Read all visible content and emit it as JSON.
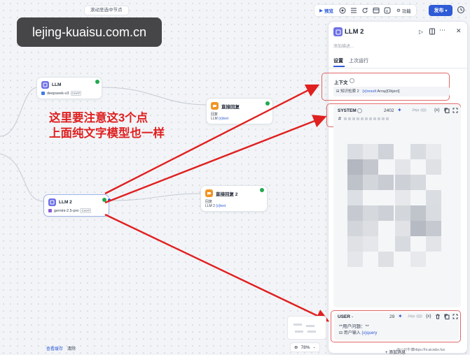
{
  "toolbar": {
    "scroll_hint": "滚动至选中节点",
    "preview_label": "预览",
    "features_label": "功能",
    "publish_label": "发布",
    "publish_caret": "▾"
  },
  "watermark": {
    "text": "lejing-kuaisu.com.cn"
  },
  "nodes": {
    "llm1": {
      "title": "LLM",
      "model": "deepseek-v3",
      "model_tag": "CHAT"
    },
    "reply1": {
      "title": "直接回复",
      "label": "回复",
      "var_node": "LLM",
      "var_name": "{x}text"
    },
    "llm2": {
      "title": "LLM 2",
      "model": "gemini-2.5-pro",
      "model_tag": "CHAT"
    },
    "reply2": {
      "title": "直接回复 2",
      "label": "回复",
      "var_node": "LLM 2",
      "var_name": "{x}text"
    }
  },
  "annotation": {
    "line1": "这里要注意这3个点",
    "line2": "上面纯文字模型也一样",
    "color": "#e02020"
  },
  "panel": {
    "title": "LLM 2",
    "description_placeholder": "添加描述...",
    "tabs": [
      {
        "label": "设置"
      },
      {
        "label": "上次运行"
      }
    ],
    "context": {
      "label": "上下文",
      "source_node": "知识检索 2",
      "var_name": "{x}result",
      "var_type": "Array[Object]"
    },
    "system": {
      "label": "SYSTEM",
      "token_count": "2402",
      "jinja_label": "Jinja",
      "first_char": "#"
    },
    "user": {
      "label": "USER",
      "token_count": "29",
      "jinja_label": "Jinja",
      "question_line": "**用户问题：**",
      "var_node": "用户输入",
      "var_name": "{x}query"
    },
    "add_message": "+ 添加消息"
  },
  "bottom": {
    "view_cache": "查看缓存",
    "clear": "清除",
    "zoom": "78%"
  },
  "credit": "@一只牛博https://hi.aicwbo.fun",
  "colors": {
    "accent": "#2f5bd6",
    "llm_icon": "#6e71e5",
    "reply_icon": "#f29424",
    "status_ok": "#22a851",
    "annotation_red": "#e02020"
  }
}
